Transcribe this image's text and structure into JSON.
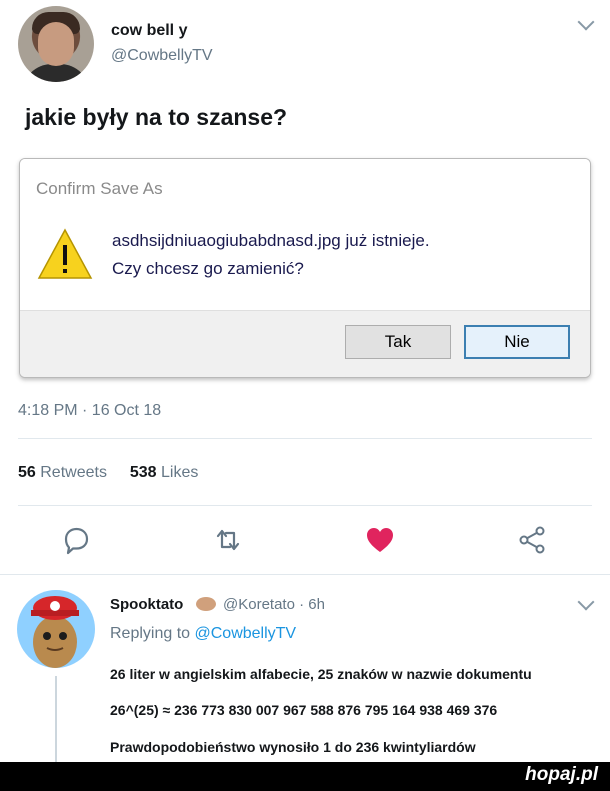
{
  "tweet": {
    "display_name": "cow bell y",
    "handle": "@CowbellyTV",
    "text": "jakie były na to szanse?",
    "timestamp": "4:18 PM · 16 Oct 18",
    "retweets_count": "56",
    "retweets_label": "Retweets",
    "likes_count": "538",
    "likes_label": "Likes"
  },
  "dialog": {
    "title": "Confirm Save As",
    "message_line1": "asdhsijdniuaogiubabdnasd.jpg już istnieje.",
    "message_line2": "Czy chcesz go zamienić?",
    "yes_label": "Tak",
    "no_label": "Nie"
  },
  "actions": {
    "reply_icon": "reply-icon",
    "retweet_icon": "retweet-icon",
    "like_icon": "heart-icon",
    "share_icon": "share-icon",
    "like_color": "#e0245e"
  },
  "reply": {
    "display_name": "Spooktato",
    "handle_time": "@Koretato · 6h",
    "replying_prefix": "Replying to",
    "replying_to": "@CowbellyTV",
    "line1": "26 liter w angielskim alfabecie, 25 znaków w nazwie dokumentu",
    "line2": "26^(25) ≈ 236 773 830 007 967 588  876 795 164 938 469 376",
    "line3": "Prawdopodobieństwo wynosiło 1 do 236 kwintyliardów"
  },
  "watermark": "hopaj.pl"
}
